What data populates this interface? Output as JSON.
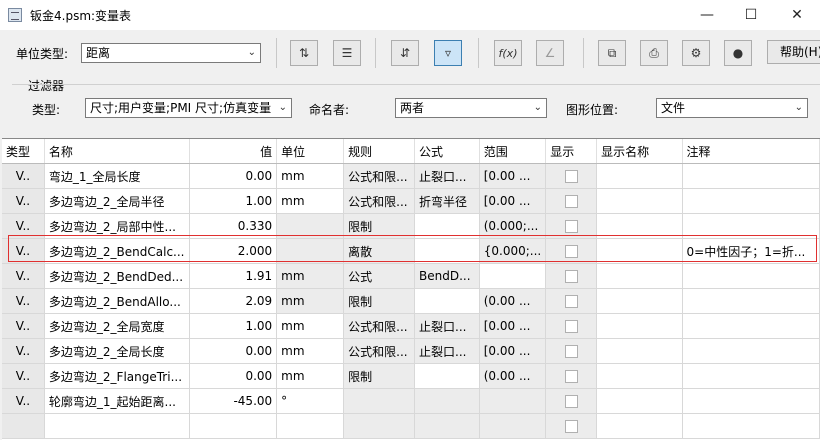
{
  "window": {
    "title": "钣金4.psm:变量表"
  },
  "toolbar": {
    "unit_type_label": "单位类型:",
    "unit_type_value": "距离",
    "help_label": "帮助(H)",
    "fx_label": "f(x)"
  },
  "filter": {
    "group_title": "过滤器",
    "type_label": "类型:",
    "type_value": "尺寸;用户变量;PMI 尺寸;仿真变量",
    "naming_label": "命名者:",
    "naming_value": "两者",
    "position_label": "图形位置:",
    "position_value": "文件"
  },
  "table": {
    "headers": [
      "类型",
      "名称",
      "值",
      "单位",
      "规则",
      "公式",
      "范围",
      "显示",
      "显示名称",
      "注释"
    ],
    "rows": [
      {
        "type": "V..",
        "name": "弯边_1_全局长度",
        "value": "0.00",
        "unit": "mm",
        "rule": "公式和限...",
        "formula": "止裂口...",
        "range": "[0.00 ...",
        "display_name": "",
        "note": ""
      },
      {
        "type": "V..",
        "name": "多边弯边_2_全局半径",
        "value": "1.00",
        "unit": "mm",
        "rule": "公式和限...",
        "formula": "折弯半径",
        "range": "[0.00 ...",
        "display_name": "",
        "note": ""
      },
      {
        "type": "V..",
        "name": "多边弯边_2_局部中性...",
        "value": "0.330",
        "unit": "",
        "rule": "限制",
        "formula": "",
        "range": "(0.000;...",
        "display_name": "",
        "note": ""
      },
      {
        "type": "V..",
        "name": "多边弯边_2_BendCalc...",
        "value": "2.000",
        "unit": "",
        "rule": "离散",
        "formula": "",
        "range": "{0.000;...",
        "display_name": "",
        "note": "0=中性因子；1=折..."
      },
      {
        "type": "V..",
        "name": "多边弯边_2_BendDed...",
        "value": "1.91",
        "unit": "mm",
        "rule": "公式",
        "formula": "BendD...",
        "range": "",
        "display_name": "",
        "note": ""
      },
      {
        "type": "V..",
        "name": "多边弯边_2_BendAllo...",
        "value": "2.09",
        "unit": "mm",
        "rule": "限制",
        "formula": "",
        "range": "(0.00 ...",
        "display_name": "",
        "note": ""
      },
      {
        "type": "V..",
        "name": "多边弯边_2_全局宽度",
        "value": "1.00",
        "unit": "mm",
        "rule": "公式和限...",
        "formula": "止裂口...",
        "range": "[0.00 ...",
        "display_name": "",
        "note": ""
      },
      {
        "type": "V..",
        "name": "多边弯边_2_全局长度",
        "value": "0.00",
        "unit": "mm",
        "rule": "公式和限...",
        "formula": "止裂口...",
        "range": "[0.00 ...",
        "display_name": "",
        "note": ""
      },
      {
        "type": "V..",
        "name": "多边弯边_2_FlangeTri...",
        "value": "0.00",
        "unit": "mm",
        "rule": "限制",
        "formula": "",
        "range": "(0.00 ...",
        "display_name": "",
        "note": ""
      },
      {
        "type": "V..",
        "name": "轮廓弯边_1_起始距离...",
        "value": "-45.00",
        "unit": "°",
        "rule": "",
        "formula": "",
        "range": "",
        "display_name": "",
        "note": ""
      }
    ]
  },
  "colors": {
    "highlight": "#e03030",
    "active_button": "#cce4f7"
  }
}
